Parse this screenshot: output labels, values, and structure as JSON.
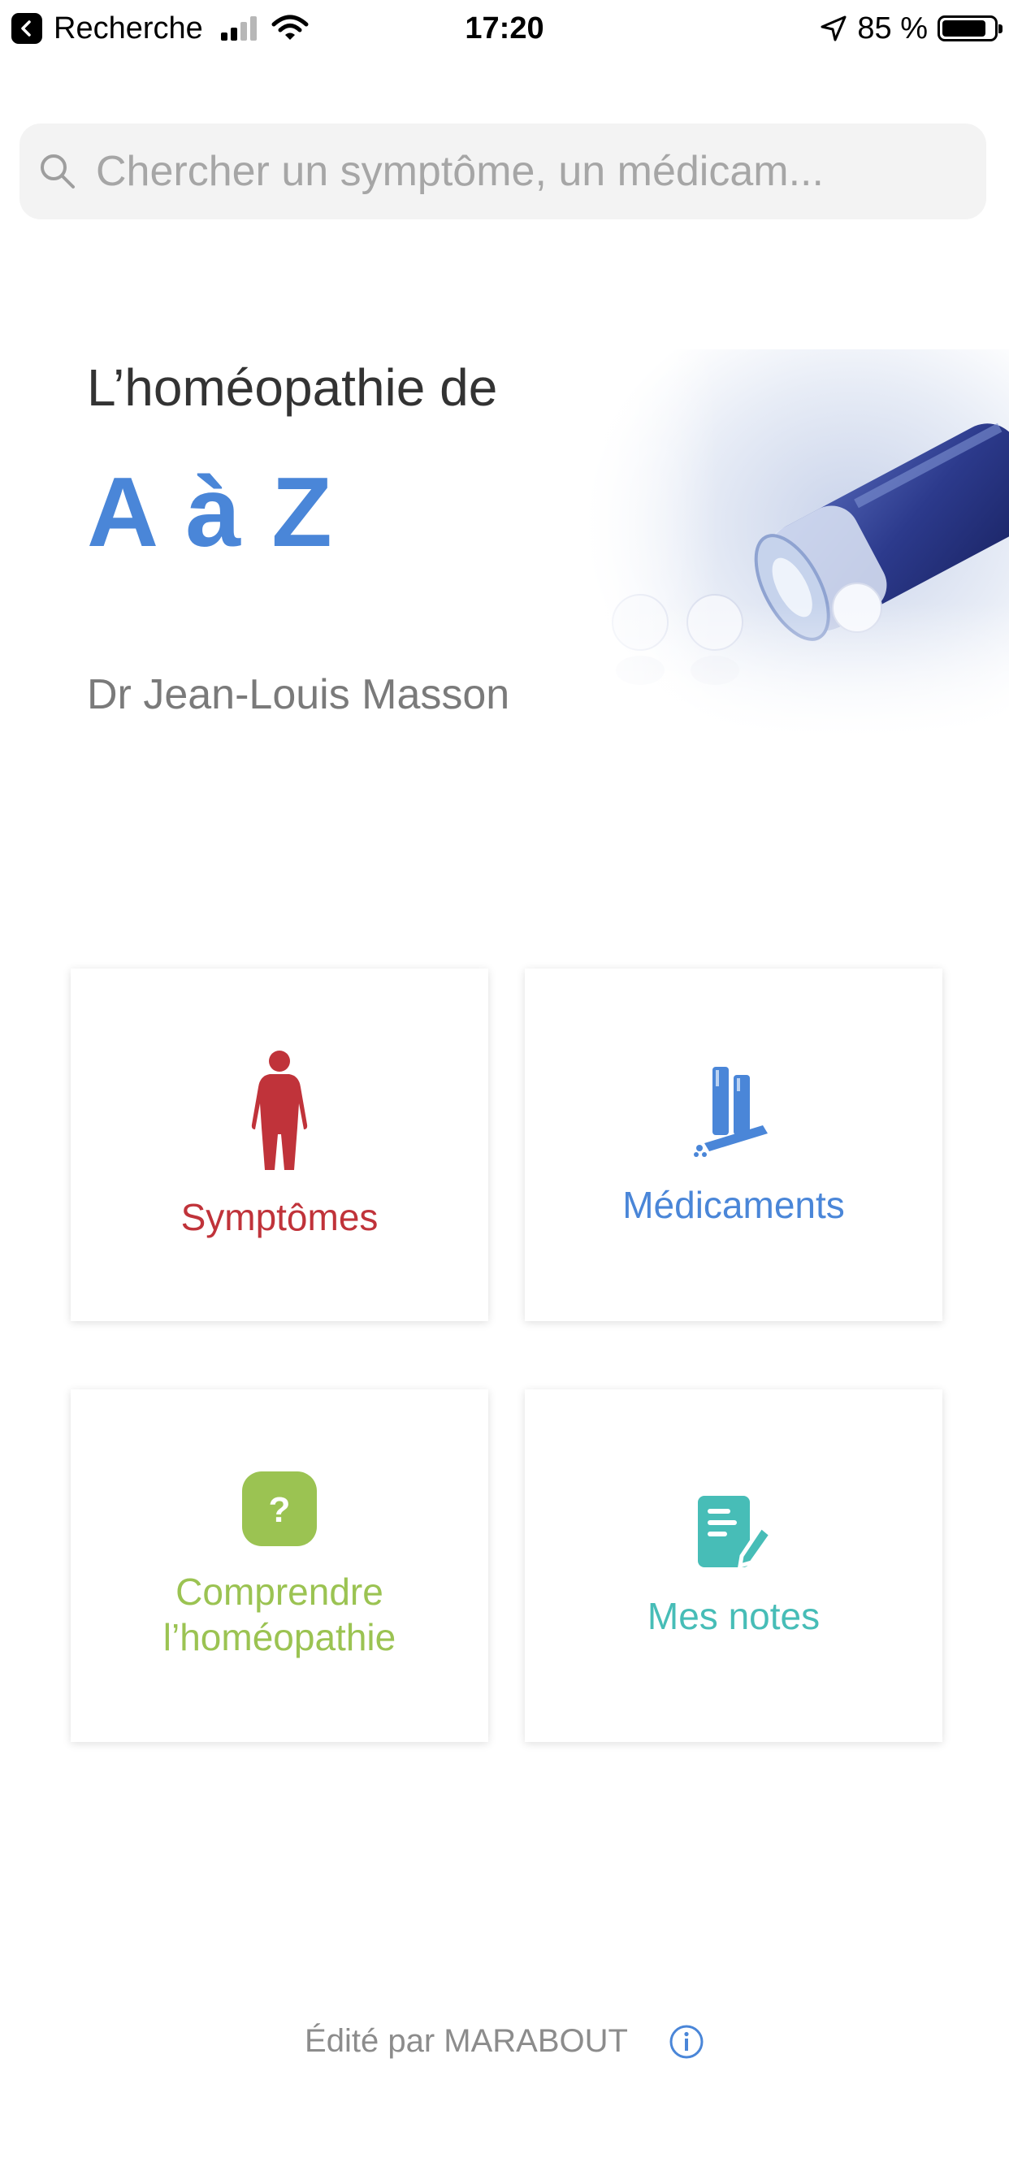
{
  "status_bar": {
    "back_app": "Recherche",
    "time": "17:20",
    "battery": "85 %",
    "battery_level": 0.85
  },
  "search": {
    "placeholder": "Chercher un symptôme, un médicam..."
  },
  "hero": {
    "title": "L’homéopathie de",
    "subtitle": "A à Z",
    "author": "Dr Jean-Louis Masson"
  },
  "tiles": [
    {
      "label": "Symptômes",
      "color": "#c0333a",
      "icon": "human-body-icon"
    },
    {
      "label": "Médicaments",
      "color": "#4a86d8",
      "icon": "medicine-tubes-icon"
    },
    {
      "label": "Comprendre\nl’homéopathie",
      "color": "#9bc352",
      "icon": "question-icon"
    },
    {
      "label": "Mes notes",
      "color": "#47bdb7",
      "icon": "notes-icon"
    }
  ],
  "footer": {
    "text": "Édité par MARABOUT",
    "info_color": "#4a86d8"
  }
}
